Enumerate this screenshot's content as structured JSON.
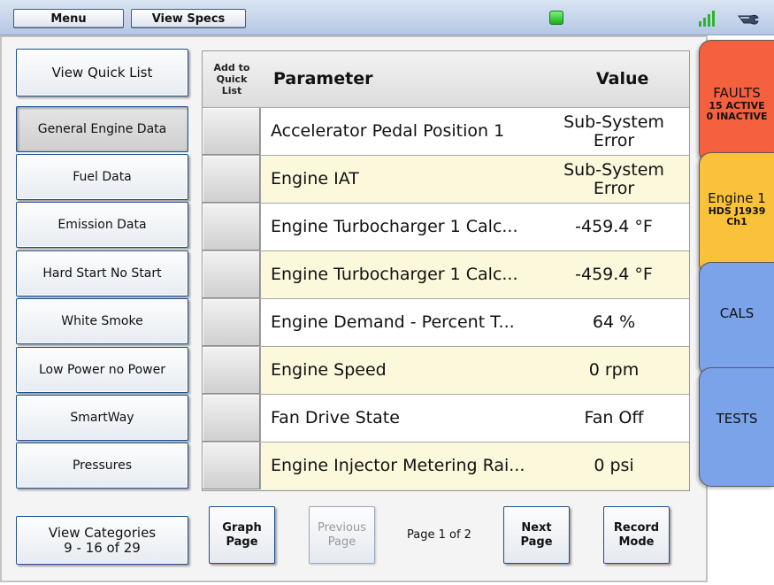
{
  "toolbar": {
    "menu_label": "Menu",
    "view_specs_label": "View Specs",
    "status_color": "#17b017"
  },
  "sidebar": {
    "view_quick_list": "View Quick List",
    "categories": [
      {
        "label": "General Engine Data",
        "active": true
      },
      {
        "label": "Fuel Data",
        "active": false
      },
      {
        "label": "Emission Data",
        "active": false
      },
      {
        "label": "Hard Start No Start",
        "active": false
      },
      {
        "label": "White Smoke",
        "active": false
      },
      {
        "label": "Low Power no Power",
        "active": false
      },
      {
        "label": "SmartWay",
        "active": false
      },
      {
        "label": "Pressures",
        "active": false
      }
    ],
    "view_categories_line1": "View Categories",
    "view_categories_line2": "9 - 16 of 29"
  },
  "table": {
    "col_add": "Add to\nQuick\nList",
    "col_add_lines": [
      "Add to",
      "Quick",
      "List"
    ],
    "col_parameter": "Parameter",
    "col_value": "Value",
    "rows": [
      {
        "parameter": "Accelerator Pedal Position 1",
        "value_lines": [
          "Sub-System",
          "Error"
        ]
      },
      {
        "parameter": "Engine IAT",
        "value_lines": [
          "Sub-System",
          "Error"
        ]
      },
      {
        "parameter": "Engine Turbocharger 1 Calc...",
        "value_lines": [
          "-459.4 °F"
        ]
      },
      {
        "parameter": "Engine Turbocharger 1 Calc...",
        "value_lines": [
          "-459.4 °F"
        ]
      },
      {
        "parameter": "Engine Demand - Percent T...",
        "value_lines": [
          "64 %"
        ]
      },
      {
        "parameter": "Engine Speed",
        "value_lines": [
          "0 rpm"
        ]
      },
      {
        "parameter": "Fan Drive State",
        "value_lines": [
          "Fan Off"
        ]
      },
      {
        "parameter": "Engine Injector Metering Rai...",
        "value_lines": [
          "0 psi"
        ]
      }
    ]
  },
  "footer": {
    "graph_page": [
      "Graph",
      "Page"
    ],
    "previous_page": [
      "Previous",
      "Page"
    ],
    "page_indicator": "Page 1 of 2",
    "next_page": [
      "Next",
      "Page"
    ],
    "record_mode": [
      "Record",
      "Mode"
    ]
  },
  "tabs": {
    "faults": {
      "title": "FAULTS",
      "line2": "15 ACTIVE",
      "line3": "0 INACTIVE",
      "color": "#f5603f"
    },
    "engine": {
      "title": "Engine 1",
      "line2": "HDS J1939",
      "line3": "Ch1",
      "color": "#f9c23a"
    },
    "cals": {
      "title": "CALS",
      "color": "#7aa3ea"
    },
    "tests": {
      "title": "TESTS",
      "color": "#7aa3ea"
    }
  },
  "icons": {
    "status": "status-light-icon",
    "signal": "signal-strength-icon",
    "tools": "wrench-icon"
  }
}
